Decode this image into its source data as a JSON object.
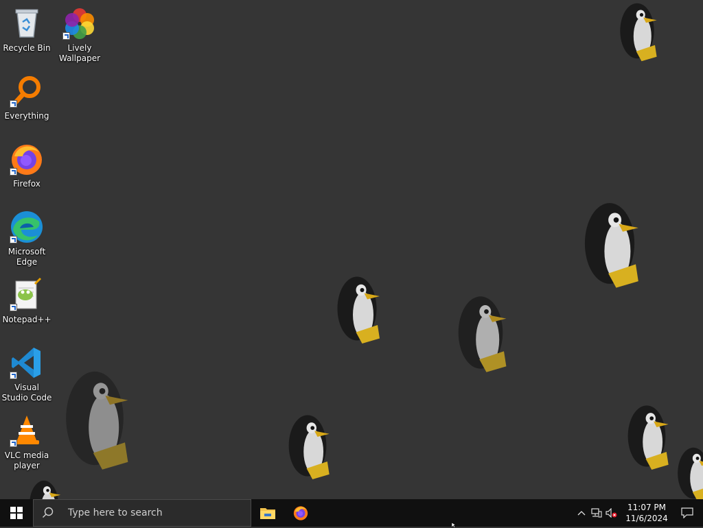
{
  "desktop": {
    "icons": [
      {
        "label": "Recycle Bin",
        "icon": "recycle-bin-icon",
        "shortcut": false
      },
      {
        "label": "Lively Wallpaper",
        "icon": "lively-wallpaper-icon",
        "shortcut": true
      },
      {
        "label": "Everything",
        "icon": "everything-search-icon",
        "shortcut": true
      },
      {
        "label": "Firefox",
        "icon": "firefox-icon",
        "shortcut": true
      },
      {
        "label": "Microsoft Edge",
        "icon": "edge-icon",
        "shortcut": true
      },
      {
        "label": "Notepad++",
        "icon": "notepad-plus-plus-icon",
        "shortcut": true
      },
      {
        "label": "Visual Studio Code",
        "icon": "vscode-icon",
        "shortcut": true
      },
      {
        "label": "VLC media player",
        "icon": "vlc-icon",
        "shortcut": true
      }
    ]
  },
  "taskbar": {
    "search_placeholder": "Type here to search",
    "pinned": [
      {
        "name": "File Explorer",
        "icon": "file-explorer-icon"
      },
      {
        "name": "Firefox",
        "icon": "firefox-icon"
      }
    ],
    "tray": {
      "icons": [
        "chevron-up-icon",
        "network-icon",
        "volume-muted-icon"
      ],
      "time": "11:07 PM",
      "date": "11/6/2024"
    }
  },
  "colors": {
    "wallpaper_bg": "#353535",
    "taskbar_bg": "#101010",
    "search_bg": "#2b2b2b"
  }
}
